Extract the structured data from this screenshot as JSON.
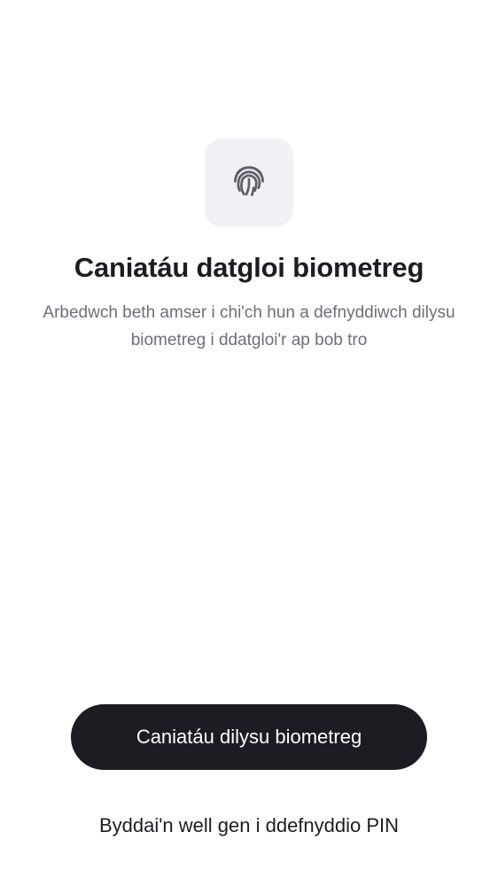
{
  "hero": {
    "icon": "fingerprint-icon",
    "title": "Caniatáu datgloi biometreg",
    "description": "Arbedwch beth amser i chi'ch hun a defnyddiwch dilysu biometreg i ddatgloi'r ap bob tro"
  },
  "actions": {
    "primary_label": "Caniatáu dilysu biometreg",
    "secondary_label": "Byddai'n well gen i ddefnyddio PIN"
  },
  "colors": {
    "background": "#ffffff",
    "icon_tile": "#f0f1f4",
    "primary_button": "#1c1d22",
    "title_text": "#1c1d22",
    "body_text": "#6b6f78"
  }
}
